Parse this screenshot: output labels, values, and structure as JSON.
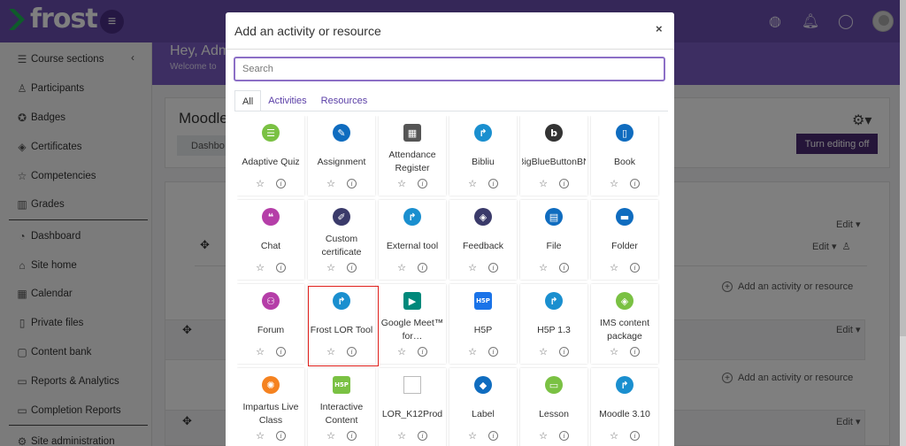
{
  "brand": {
    "name": "frost"
  },
  "topbar": {
    "icons": [
      "globe-icon",
      "bell-icon",
      "chat-icon",
      "avatar"
    ]
  },
  "sidebar": {
    "items": [
      {
        "label": "Course sections",
        "icon": "list-icon"
      },
      {
        "label": "Participants",
        "icon": "user-icon"
      },
      {
        "label": "Badges",
        "icon": "badge-icon"
      },
      {
        "label": "Certificates",
        "icon": "layers-icon"
      },
      {
        "label": "Competencies",
        "icon": "star-icon"
      },
      {
        "label": "Grades",
        "icon": "book-icon"
      },
      {
        "label": "Dashboard",
        "icon": "speedometer-icon"
      },
      {
        "label": "Site home",
        "icon": "home-icon"
      },
      {
        "label": "Calendar",
        "icon": "calendar-icon"
      },
      {
        "label": "Private files",
        "icon": "file-icon"
      },
      {
        "label": "Content bank",
        "icon": "cube-icon"
      },
      {
        "label": "Reports & Analytics",
        "icon": "folder-icon"
      },
      {
        "label": "Completion Reports",
        "icon": "folder-icon"
      },
      {
        "label": "Site administration",
        "icon": "gear-icon"
      }
    ]
  },
  "hero": {
    "title": "Hey, Adm",
    "subtitle": "Welcome to"
  },
  "course": {
    "title": "Moodle",
    "dashboard_tab": "Dashbo",
    "edit_button": "Turn editing off"
  },
  "background": {
    "edit": "Edit",
    "add_activity": "Add an activity or resource"
  },
  "modal": {
    "title": "Add an activity or resource",
    "close": "×",
    "search_placeholder": "Search",
    "tabs": [
      "All",
      "Activities",
      "Resources"
    ],
    "tiles": [
      {
        "name": "Adaptive Quiz",
        "icon": "list-icon",
        "color": "#7ac143",
        "glyph": "☰"
      },
      {
        "name": "Assignment",
        "icon": "assignment-icon",
        "color": "#0f6cbf",
        "glyph": "✎"
      },
      {
        "name": "Attendance Register",
        "icon": "register-icon",
        "color": "#555555",
        "glyph": "▦"
      },
      {
        "name": "Bibliu",
        "icon": "external-icon",
        "color": "#1a8fcf",
        "glyph": "↱"
      },
      {
        "name": "BigBlueButtonBN",
        "icon": "bigbluebutton-icon",
        "color": "#333333",
        "glyph": "b"
      },
      {
        "name": "Book",
        "icon": "book-icon",
        "color": "#0f6cbf",
        "glyph": "▯"
      },
      {
        "name": "Chat",
        "icon": "chat-icon",
        "color": "#b53ea8",
        "glyph": "❝"
      },
      {
        "name": "Custom certificate",
        "icon": "certificate-icon",
        "color": "#3a3a6a",
        "glyph": "✐"
      },
      {
        "name": "External tool",
        "icon": "external-icon",
        "color": "#1a8fcf",
        "glyph": "↱"
      },
      {
        "name": "Feedback",
        "icon": "feedback-icon",
        "color": "#3a3a6a",
        "glyph": "◈"
      },
      {
        "name": "File",
        "icon": "file-icon",
        "color": "#0f6cbf",
        "glyph": "▤"
      },
      {
        "name": "Folder",
        "icon": "folder-icon",
        "color": "#0f6cbf",
        "glyph": "▬"
      },
      {
        "name": "Forum",
        "icon": "forum-icon",
        "color": "#b53ea8",
        "glyph": "⚇"
      },
      {
        "name": "Frost LOR Tool",
        "icon": "external-icon",
        "color": "#1a8fcf",
        "glyph": "↱"
      },
      {
        "name": "Google Meet™ for…",
        "icon": "google-meet-icon",
        "color": "#00897b",
        "glyph": "▶"
      },
      {
        "name": "H5P",
        "icon": "h5p-icon",
        "color": "#1a73e8",
        "glyph": "H5P"
      },
      {
        "name": "H5P 1.3",
        "icon": "external-icon",
        "color": "#1a8fcf",
        "glyph": "↱"
      },
      {
        "name": "IMS content package",
        "icon": "package-icon",
        "color": "#7ac143",
        "glyph": "◈"
      },
      {
        "name": "Impartus Live Class",
        "icon": "impartus-icon",
        "color": "#f58220",
        "glyph": "✺"
      },
      {
        "name": "Interactive Content",
        "icon": "h5p-icon",
        "color": "#7ac143",
        "glyph": "H5P"
      },
      {
        "name": "LOR_K12Prod",
        "icon": "broken-image-icon",
        "color": "#ffffff",
        "glyph": ""
      },
      {
        "name": "Label",
        "icon": "label-icon",
        "color": "#0f6cbf",
        "glyph": "◆"
      },
      {
        "name": "Lesson",
        "icon": "lesson-icon",
        "color": "#7ac143",
        "glyph": "▭"
      },
      {
        "name": "Moodle 3.10",
        "icon": "external-icon",
        "color": "#1a8fcf",
        "glyph": "↱"
      }
    ]
  }
}
